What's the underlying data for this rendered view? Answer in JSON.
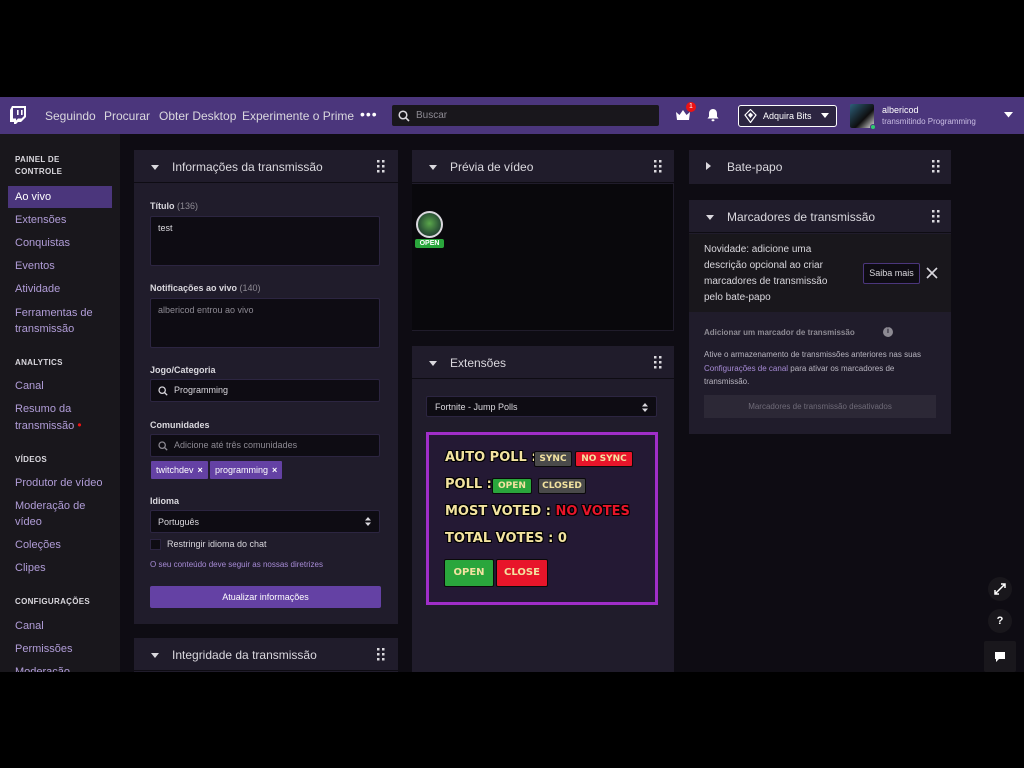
{
  "nav": {
    "links": [
      "Seguindo",
      "Procurar",
      "Obter Desktop",
      "Experimente o Prime"
    ],
    "more": "•••",
    "search_placeholder": "Buscar",
    "crown_badge": "1",
    "bits_label": "Adquira Bits",
    "user_name": "albericod",
    "user_status": "transmitindo Programming"
  },
  "sidebar": {
    "section_panel": "PAINEL DE CONTROLE",
    "panel_items": [
      "Ao vivo",
      "Extensões",
      "Conquistas",
      "Eventos",
      "Atividade",
      "Ferramentas de transmissão"
    ],
    "section_analytics": "ANALYTICS",
    "analytics_items": [
      "Canal",
      "Resumo da transmissão"
    ],
    "section_videos": "VÍDEOS",
    "video_items": [
      "Produtor de vídeo",
      "Moderação de vídeo",
      "Coleções",
      "Clipes"
    ],
    "section_config": "CONFIGURAÇÕES",
    "config_items": [
      "Canal",
      "Permissões",
      "Moderação"
    ],
    "alert_dot": "•"
  },
  "stream_info": {
    "panel_title": "Informações da transmissão",
    "title_label": "Título",
    "title_count": "(136)",
    "title_value": "test",
    "notif_label": "Notificações ao vivo",
    "notif_count": "(140)",
    "notif_placeholder": "albericod entrou ao vivo",
    "game_label": "Jogo/Categoria",
    "game_value": "Programming",
    "communities_label": "Comunidades",
    "communities_placeholder": "Adicione até três comunidades",
    "tags": [
      "twitchdev",
      "programming"
    ],
    "tag_remove": "×",
    "language_label": "Idioma",
    "language_value": "Português",
    "restrict_label": "Restringir idioma do chat",
    "guidelines_note": "O seu conteúdo deve seguir as nossas diretrizes",
    "update_button": "Atualizar informações"
  },
  "health": {
    "panel_title": "Integridade da transmissão"
  },
  "video_preview": {
    "panel_title": "Prévia de vídeo",
    "overlay_label": "OPEN"
  },
  "extensions": {
    "panel_title": "Extensões",
    "selected": "Fortnite - Jump Polls",
    "auto_poll_label": "AUTO POLL :",
    "sync_label": "SYNC",
    "no_sync_label": "NO SYNC",
    "poll_label": "POLL :",
    "poll_open": "OPEN",
    "poll_closed": "CLOSED",
    "most_voted_label": "MOST VOTED :",
    "most_voted_value": "NO VOTES",
    "total_votes_label": "TOTAL VOTES :",
    "total_votes_value": "0",
    "open_button": "OPEN",
    "close_button": "CLOSE"
  },
  "chat_panel": {
    "panel_title": "Bate-papo"
  },
  "markers": {
    "panel_title": "Marcadores de transmissão",
    "notice": "Novidade: adicione uma descrição opcional ao criar marcadores de transmissão pelo bate-papo",
    "learn_more": "Saiba mais",
    "add_label": "Adicionar um marcador de transmissão",
    "info_glyph": "i",
    "desc_before": "Ative o armazenamento de transmissões anteriores nas suas",
    "desc_link": "Configurações de canal",
    "desc_after": "para ativar os marcadores de transmissão.",
    "disabled_button": "Marcadores de transmissão desativados"
  },
  "floating": {
    "help": "?"
  },
  "colors": {
    "topbar": "#4b367c",
    "accent": "#6441a4",
    "extension_border": "#a02ec9",
    "open_green": "#2aa63c",
    "close_red": "#e8152a"
  }
}
